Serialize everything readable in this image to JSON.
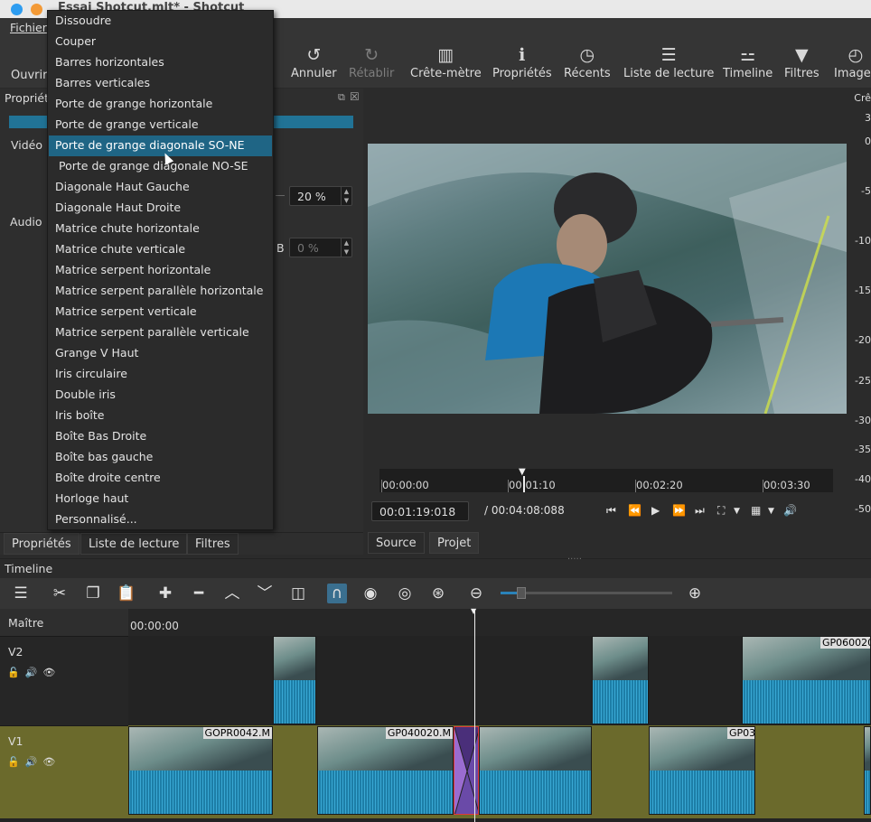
{
  "window": {
    "title": "Essai Shotcut.mlt* - Shotcut"
  },
  "menubar": {
    "file": "Fichier"
  },
  "toolbar": {
    "open": "Ouvrir",
    "undo": "Annuler",
    "redo": "Rétablir",
    "peak_meter": "Crête-mètre",
    "properties": "Propriétés",
    "recent": "Récents",
    "playlist": "Liste de lecture",
    "timeline": "Timeline",
    "filters": "Filtres",
    "keyframes": "Images"
  },
  "properties_panel": {
    "title": "Propriét",
    "video_label": "Vidéo",
    "audio_label": "Audio",
    "softness_value": "20 %",
    "b_label": "B",
    "b_value": "0 %"
  },
  "left_tabs": [
    "Propriétés",
    "Liste de lecture",
    "Filtres"
  ],
  "player": {
    "ruler_labels": [
      "00:00:00",
      "00:01:10",
      "00:02:20",
      "00:03:30"
    ],
    "current_time": "00:01:19:018",
    "total_time": "/ 00:04:08:088",
    "tabs": [
      "Source",
      "Projet"
    ]
  },
  "meter_labels": [
    "Crê",
    "3",
    "0",
    "-5",
    "-10",
    "-15",
    "-20",
    "-25",
    "-30",
    "-35",
    "-40",
    "-50"
  ],
  "timeline": {
    "header": "Timeline",
    "master": "Maître",
    "start_time": "00:00:00",
    "tracks": [
      {
        "name": "V2"
      },
      {
        "name": "V1"
      }
    ],
    "clip_names": [
      "GOPR0042.M",
      "GP040020.M",
      "GP03",
      "GP060020"
    ],
    "zoom_level": 0.12
  },
  "transition_menu": {
    "items": [
      "Dissoudre",
      "Couper",
      "Barres horizontales",
      "Barres verticales",
      "Porte de grange horizontale",
      "Porte de grange verticale",
      "Porte de grange diagonale SO-NE",
      "Porte de grange diagonale NO-SE",
      "Diagonale Haut Gauche",
      "Diagonale Haut Droite",
      "Matrice chute horizontale",
      "Matrice chute verticale",
      "Matrice serpent horizontale",
      "Matrice serpent parallèle horizontale",
      "Matrice serpent verticale",
      "Matrice serpent parallèle verticale",
      "Grange V Haut",
      "Iris circulaire",
      "Double iris",
      "Iris boîte",
      "Boîte Bas Droite",
      "Boîte bas gauche",
      "Boîte droite centre",
      "Horloge haut",
      "Personnalisé..."
    ],
    "selected_index": 6
  },
  "colors": {
    "accent": "#1f6585",
    "track_v1": "#6b6a2c",
    "waveform": "#1d7ea7"
  }
}
